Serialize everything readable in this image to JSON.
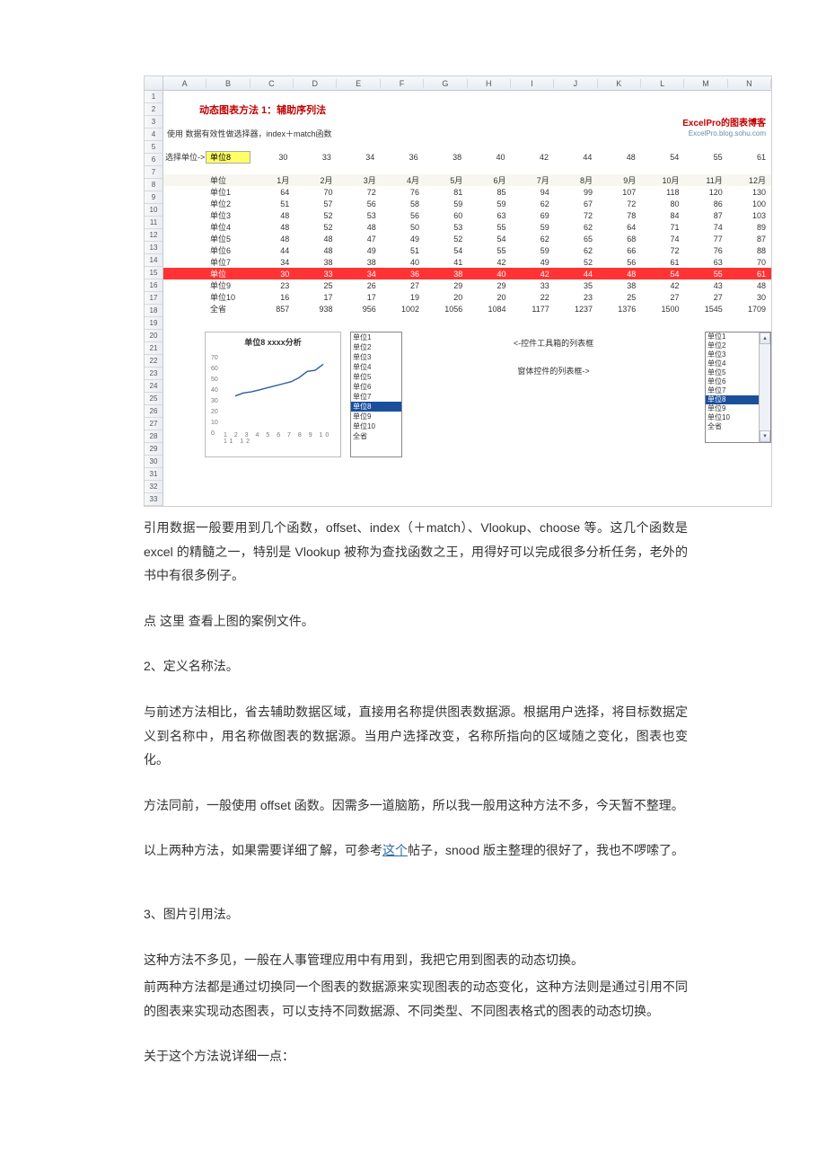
{
  "excel": {
    "columns": [
      "A",
      "B",
      "C",
      "D",
      "E",
      "F",
      "G",
      "H",
      "I",
      "J",
      "K",
      "L",
      "M",
      "N"
    ],
    "row_count": 33,
    "title": "动态图表方法 1：辅助序列法",
    "brand": "ExcelPro的图表博客",
    "brand_url": "ExcelPro.blog.sohu.com",
    "note": "使用 数据有效性做选择器，index＋match函数",
    "choose_label": "选择单位->",
    "choose_value": "单位8",
    "choose_row": [
      "30",
      "33",
      "34",
      "36",
      "38",
      "40",
      "42",
      "44",
      "48",
      "54",
      "55",
      "61"
    ],
    "months_head": "单位",
    "months": [
      "1月",
      "2月",
      "3月",
      "4月",
      "5月",
      "6月",
      "7月",
      "8月",
      "9月",
      "10月",
      "11月",
      "12月"
    ],
    "data": [
      {
        "name": "单位1",
        "v": [
          "64",
          "70",
          "72",
          "76",
          "81",
          "85",
          "94",
          "99",
          "107",
          "118",
          "120",
          "130"
        ]
      },
      {
        "name": "单位2",
        "v": [
          "51",
          "57",
          "56",
          "58",
          "59",
          "59",
          "62",
          "67",
          "72",
          "80",
          "86",
          "100"
        ]
      },
      {
        "name": "单位3",
        "v": [
          "48",
          "52",
          "53",
          "56",
          "60",
          "63",
          "69",
          "72",
          "78",
          "84",
          "87",
          "103"
        ]
      },
      {
        "name": "单位4",
        "v": [
          "48",
          "52",
          "48",
          "50",
          "53",
          "55",
          "59",
          "62",
          "64",
          "71",
          "74",
          "89"
        ]
      },
      {
        "name": "单位5",
        "v": [
          "48",
          "48",
          "47",
          "49",
          "52",
          "54",
          "62",
          "65",
          "68",
          "74",
          "77",
          "87"
        ]
      },
      {
        "name": "单位6",
        "v": [
          "44",
          "48",
          "49",
          "51",
          "54",
          "55",
          "59",
          "62",
          "66",
          "72",
          "76",
          "88"
        ]
      },
      {
        "name": "单位7",
        "v": [
          "34",
          "38",
          "38",
          "40",
          "41",
          "42",
          "49",
          "52",
          "56",
          "61",
          "63",
          "70"
        ]
      },
      {
        "name": "单位",
        "v": [
          "30",
          "33",
          "34",
          "36",
          "38",
          "40",
          "42",
          "44",
          "48",
          "54",
          "55",
          "61"
        ],
        "hl": true
      },
      {
        "name": "单位9",
        "v": [
          "23",
          "25",
          "26",
          "27",
          "29",
          "29",
          "33",
          "35",
          "38",
          "42",
          "43",
          "48"
        ]
      },
      {
        "name": "单位10",
        "v": [
          "16",
          "17",
          "17",
          "19",
          "20",
          "20",
          "22",
          "23",
          "25",
          "27",
          "27",
          "30"
        ]
      },
      {
        "name": "全省",
        "v": [
          "857",
          "938",
          "956",
          "1002",
          "1056",
          "1084",
          "1177",
          "1237",
          "1376",
          "1500",
          "1545",
          "1709"
        ]
      }
    ],
    "mini_chart_title": "单位8 xxxx分析",
    "list1": [
      "单位1",
      "单位2",
      "单位3",
      "单位4",
      "单位5",
      "单位6",
      "单位7",
      "单位8",
      "单位9",
      "单位10",
      "全省"
    ],
    "list1_selected": "单位8",
    "anno1": "<-控件工具箱的列表框",
    "anno2": "窗体控件的列表框->",
    "list2": [
      "单位1",
      "单位2",
      "单位3",
      "单位4",
      "单位5",
      "单位6",
      "单位7",
      "单位8",
      "单位9",
      "单位10",
      "全省"
    ],
    "list2_selected": "单位8",
    "y_ticks": [
      "70",
      "60",
      "50",
      "40",
      "30",
      "20",
      "10",
      "0"
    ],
    "x_ticks": "1 2 3 4 5 6 7 8 9 10 11 12"
  },
  "chart_data": {
    "type": "line",
    "title": "单位8 xxxx分析",
    "x": [
      1,
      2,
      3,
      4,
      5,
      6,
      7,
      8,
      9,
      10,
      11,
      12
    ],
    "values": [
      30,
      33,
      34,
      36,
      38,
      40,
      42,
      44,
      48,
      54,
      55,
      61
    ],
    "xlabel": "",
    "ylabel": "",
    "ylim": [
      0,
      70
    ]
  },
  "text": {
    "p1": "引用数据一般要用到几个函数，offset、index（＋match）、Vlookup、choose 等。这几个函数是 excel 的精髓之一，特别是 Vlookup 被称为查找函数之王，用得好可以完成很多分析任务，老外的书中有很多例子。",
    "p2": "点 这里 查看上图的案例文件。",
    "p3": "2、定义名称法。",
    "p4": "与前述方法相比，省去辅助数据区域，直接用名称提供图表数据源。根据用户选择，将目标数据定义到名称中，用名称做图表的数据源。当用户选择改变，名称所指向的区域随之变化，图表也变化。",
    "p5a": "方法同前，一般使用 offset 函数。因需多一道脑筋，所以我一般用这种方法不多，今天暂不整理。",
    "p6a": "以上两种方法，如果需要详细了解，可参考",
    "p6link": "这个",
    "p6b": "帖子，snood 版主整理的很好了，我也不啰嗦了。",
    "p7": "3、图片引用法。",
    "p8": "这种方法不多见，一般在人事管理应用中有用到，我把它用到图表的动态切换。",
    "p9": "前两种方法都是通过切换同一个图表的数据源来实现图表的动态变化，这种方法则是通过引用不同的图表来实现动态图表，可以支持不同数据源、不同类型、不同图表格式的图表的动态切换。",
    "p10": "关于这个方法说详细一点："
  }
}
